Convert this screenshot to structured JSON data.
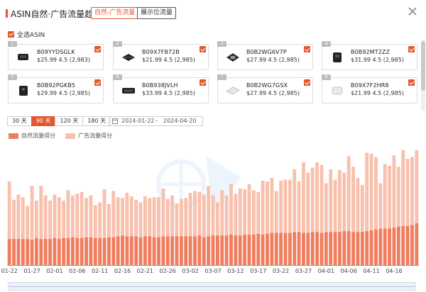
{
  "header": {
    "title": "ASIN自然·广告流量趋势",
    "modes": [
      {
        "label": "自然-广告流量",
        "active": true
      },
      {
        "label": "展示位流量",
        "active": false
      }
    ]
  },
  "select_all": {
    "label": "全选ASIN",
    "checked": true
  },
  "products": [
    {
      "num": "1",
      "asin": "B09YYDSGLK",
      "stats": "$25.99 4.5 (2,983)",
      "checked": true
    },
    {
      "num": "2",
      "asin": "B09X7FB72B",
      "stats": "$21.99 4.5 (2,985)",
      "checked": true
    },
    {
      "num": "3",
      "asin": "B0B2WG6V7P",
      "stats": "$27.99 4.5 (2,985)",
      "checked": true
    },
    {
      "num": "4",
      "asin": "B0B92MT2ZZ",
      "stats": "$31.99 4.5 (2,985)",
      "checked": true
    },
    {
      "num": "5",
      "asin": "B0B92PGKB5",
      "stats": "$29.99 4.5 (2,985)",
      "checked": true
    },
    {
      "num": "6",
      "asin": "B0B938JVLH",
      "stats": "$33.99 4.5 (2,985)",
      "checked": true
    },
    {
      "num": "7",
      "asin": "B0B2WG7GSX",
      "stats": "$27.99 4.5 (2,985)",
      "checked": true
    },
    {
      "num": "8",
      "asin": "B09X7F2HR8",
      "stats": "$21.99 4.5 (2,985)",
      "checked": true
    }
  ],
  "ranges": [
    {
      "label": "30 天",
      "active": false
    },
    {
      "label": "90 天",
      "active": true
    },
    {
      "label": "120 天",
      "active": false
    },
    {
      "label": "180 天",
      "active": false
    }
  ],
  "date_range": {
    "start": "2024-01-22",
    "separator": "-",
    "end": "2024-04-20"
  },
  "colors": {
    "accent": "#e4572e",
    "organic": "#ef7d5e",
    "ads": "#f8c1ae"
  },
  "chart_data": {
    "type": "bar",
    "stacked": true,
    "series": [
      {
        "name": "自然流量得分",
        "color": "#ef7d5e",
        "values": [
          30,
          30,
          30,
          30,
          30,
          29,
          31,
          30,
          30,
          30,
          31,
          30,
          31,
          31,
          32,
          31,
          31,
          32,
          32,
          31,
          31,
          31,
          32,
          32,
          33,
          34,
          33,
          33,
          33,
          32,
          33,
          33,
          32,
          32,
          33,
          33,
          33,
          33,
          33,
          33,
          33,
          33,
          34,
          32,
          33,
          34,
          34,
          34,
          34,
          35,
          34,
          34,
          35,
          35,
          35,
          36,
          35,
          36,
          37,
          37,
          37,
          37,
          37,
          38,
          38,
          37,
          37,
          38,
          38,
          37,
          38,
          38,
          38,
          38,
          39,
          39,
          38,
          38,
          38,
          39,
          40,
          41,
          42,
          42,
          42,
          43,
          44,
          45,
          45,
          46,
          48
        ]
      },
      {
        "name": "广告流量得分",
        "color": "#f8c1ae",
        "values": [
          66,
          45,
          51,
          48,
          38,
          62,
          43,
          61,
          50,
          44,
          50,
          48,
          43,
          55,
          48,
          51,
          53,
          45,
          48,
          38,
          41,
          56,
          38,
          53,
          45,
          43,
          50,
          46,
          42,
          40,
          46,
          44,
          46,
          46,
          55,
          43,
          47,
          38,
          43,
          44,
          50,
          52,
          50,
          49,
          58,
          46,
          38,
          52,
          46,
          58,
          48,
          54,
          52,
          58,
          51,
          48,
          62,
          60,
          63,
          48,
          60,
          61,
          61,
          72,
          58,
          81,
          69,
          74,
          80,
          78,
          56,
          72,
          60,
          71,
          67,
          86,
          75,
          62,
          54,
          90,
          88,
          83,
          52,
          74,
          72,
          83,
          69,
          87,
          77,
          78,
          84
        ]
      },
      {
        "name": "",
        "color": "#ef7d5e",
        "note_hidden": true
      }
    ],
    "x_tick_labels": [
      "01-22",
      "01-27",
      "02-01",
      "02-06",
      "02-11",
      "02-16",
      "02-21",
      "02-26",
      "03-02",
      "03-07",
      "03-12",
      "03-17",
      "03-22",
      "03-27",
      "04-01",
      "04-06",
      "04-11",
      "04-16"
    ],
    "grid": false,
    "legend_position": "top-left"
  }
}
